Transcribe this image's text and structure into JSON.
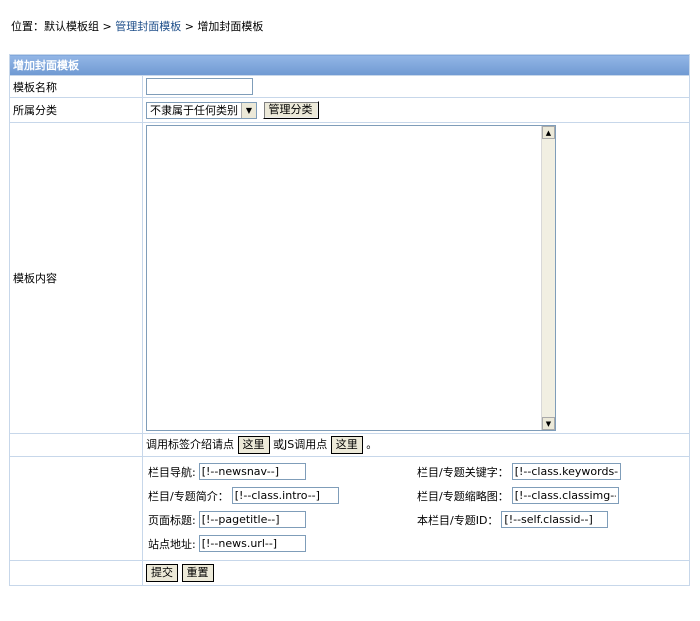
{
  "breadcrumb": {
    "prefix": "位置：默认模板组 > ",
    "link": "管理封面模板",
    "suffix": " > 增加封面模板"
  },
  "form": {
    "title": "增加封面模板",
    "name_label": "模板名称",
    "name_value": "",
    "category_label": "所属分类",
    "category_selected": "不隶属于任何类别",
    "manage_category_button": "管理分类",
    "content_label": "模板内容",
    "content_value": "",
    "help_text_1": "调用标签介绍请点",
    "help_link_1": "这里",
    "help_text_2": "或JS调用点",
    "help_link_2": "这里",
    "help_end": "。",
    "submit_button": "提交",
    "reset_button": "重置"
  },
  "vars": {
    "nav_label": "栏目导航:",
    "nav_value": "[!--newsnav--]",
    "intro_label": "栏目/专题简介：",
    "intro_value": "[!--class.intro--]",
    "title_label": "页面标题:",
    "title_value": "[!--pagetitle--]",
    "url_label": "站点地址:",
    "url_value": "[!--news.url--]",
    "keywords_label": "栏目/专题关键字：",
    "keywords_value": "[!--class.keywords--]",
    "classimg_label": "栏目/专题缩略图：",
    "classimg_value": "[!--class.classimg--]",
    "classid_label": "本栏目/专题ID：",
    "classid_value": "[!--self.classid--]"
  }
}
